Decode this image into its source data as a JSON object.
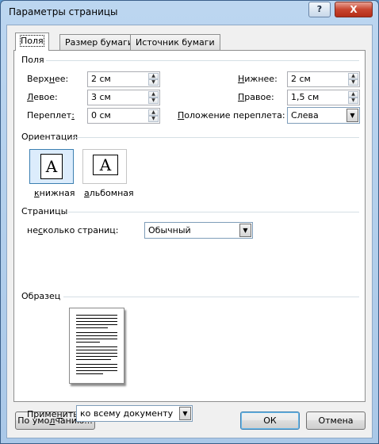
{
  "window": {
    "title": "Параметры страницы",
    "help_label": "?",
    "close_label": "X"
  },
  "tabs": [
    {
      "label": "Поля",
      "active": true
    },
    {
      "label": "Размер бумаги",
      "active": false
    },
    {
      "label": "Источник бумаги",
      "active": false
    }
  ],
  "margins": {
    "group_title": "Поля",
    "top_label": "Верхнее:",
    "top_value": "2 см",
    "bottom_label": "Нижнее:",
    "bottom_value": "2 см",
    "left_label": "Левое:",
    "left_value": "3 см",
    "right_label": "Правое:",
    "right_value": "1,5 см",
    "gutter_label": "Переплет:",
    "gutter_value": "0 см",
    "gutter_pos_label": "Положение переплета:",
    "gutter_pos_value": "Слева"
  },
  "orientation": {
    "group_title": "Ориентация",
    "portrait_label": "книжная",
    "landscape_label": "альбомная",
    "icon_glyph": "A",
    "selected": "portrait"
  },
  "pages": {
    "group_title": "Страницы",
    "multiple_label": "несколько страниц:",
    "multiple_value": "Обычный"
  },
  "preview": {
    "group_title": "Образец"
  },
  "apply": {
    "label": "Применить:",
    "value": "ко всему документу"
  },
  "buttons": {
    "default_label": "По умолчанию...",
    "ok_label": "ОК",
    "cancel_label": "Отмена"
  },
  "icons": {
    "spin_up": "▲",
    "spin_down": "▼",
    "dropdown": "▼"
  }
}
